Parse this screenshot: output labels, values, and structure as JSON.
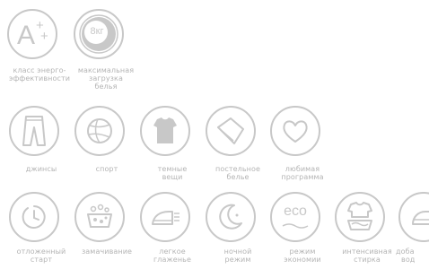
{
  "colors": {
    "icon_stroke": "#c8c8c8",
    "caption_text": "#b4b4b4",
    "badge_fill": "#c8c8c8",
    "background": "#ffffff"
  },
  "features": [
    {
      "icon": "energy-class-a-plus-plus-icon",
      "caption": [
        "класс энерго-",
        "эффективности"
      ]
    },
    {
      "icon": "max-load-8kg-icon",
      "badge": "8кг",
      "caption": [
        "максимальная",
        "загрузка",
        "белья"
      ]
    },
    {
      "icon": "jeans-icon",
      "caption": [
        "джинсы"
      ]
    },
    {
      "icon": "sport-ball-icon",
      "caption": [
        "спорт"
      ]
    },
    {
      "icon": "dark-clothes-icon",
      "caption": [
        "темные",
        "вещи"
      ]
    },
    {
      "icon": "bed-linen-icon",
      "caption": [
        "постельное",
        "белье"
      ]
    },
    {
      "icon": "heart-favorite-icon",
      "caption": [
        "любимая",
        "программа"
      ]
    },
    {
      "icon": "delayed-start-timer-icon",
      "caption": [
        "отложенный",
        "старт"
      ]
    },
    {
      "icon": "soaking-basin-icon",
      "caption": [
        "замачивание"
      ]
    },
    {
      "icon": "easy-iron-icon",
      "caption": [
        "легкое",
        "глаженье"
      ]
    },
    {
      "icon": "night-moon-icon",
      "caption": [
        "ночной",
        "режим"
      ]
    },
    {
      "icon": "eco-mode-icon",
      "badge": "eco",
      "caption": [
        "режим",
        "экономии"
      ]
    },
    {
      "icon": "intensive-wash-icon",
      "caption": [
        "интенсивная",
        "стирка"
      ]
    },
    {
      "icon": "add-laundry-icon",
      "caption": [
        "доба",
        "вод"
      ]
    }
  ]
}
